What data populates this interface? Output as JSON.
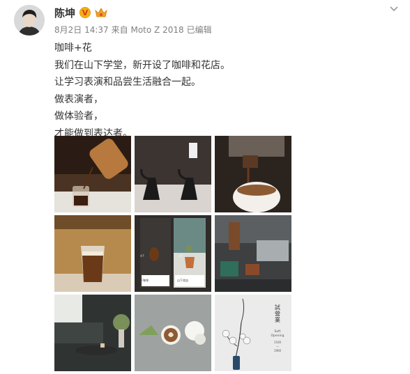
{
  "post": {
    "author": "陈坤",
    "verified_badge": "V",
    "meta": {
      "date": "8月2日 14:37",
      "source": "来自 Moto Z 2018",
      "edited": "已编辑"
    },
    "text_lines": [
      "咖啡+花",
      "我们在山下学堂，新开设了咖啡和花店。",
      "让学习表演和品尝生活融合一起。",
      "做表演者，",
      "做体验者，",
      "才能做到表达者。"
    ],
    "images": [
      {
        "icon": "coffee-pour-photo"
      },
      {
        "icon": "kettles-photo"
      },
      {
        "icon": "espresso-photo"
      },
      {
        "icon": "latte-glass-photo"
      },
      {
        "icon": "posters-photo",
        "poster_left_title": "山下",
        "poster_left_sub": "山下咖啡",
        "poster_right_title": "山下",
        "poster_right_sub": "山下花店"
      },
      {
        "icon": "cafe-interior-photo"
      },
      {
        "icon": "lounge-photo"
      },
      {
        "icon": "latte-art-photo"
      },
      {
        "icon": "flower-vase-poster",
        "poster_title": "試營業",
        "poster_lines": [
          "Soft",
          "Opening"
        ],
        "poster_hours": [
          "1100",
          "一",
          "1900"
        ]
      }
    ]
  },
  "colors": {
    "name": "#333333",
    "meta": "#808080",
    "vip_bg": "#f6b113"
  }
}
